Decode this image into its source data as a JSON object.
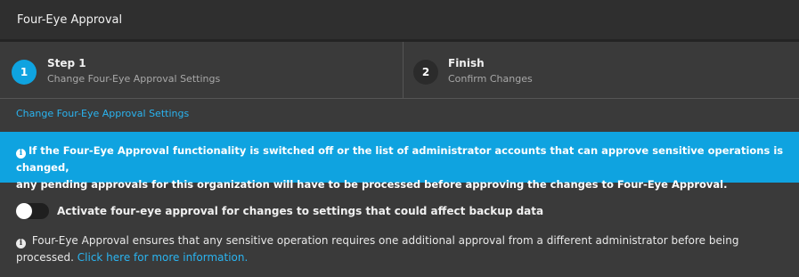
{
  "window": {
    "title": "Four-Eye Approval"
  },
  "steps": [
    {
      "number": "1",
      "title": "Step 1",
      "subtitle": "Change Four-Eye Approval Settings",
      "active": true
    },
    {
      "number": "2",
      "title": "Finish",
      "subtitle": "Confirm Changes",
      "active": false
    }
  ],
  "section": {
    "heading": "Change Four-Eye Approval Settings"
  },
  "banner": {
    "icon": "info-icon",
    "line1": "If the Four-Eye Approval functionality is switched off or the list of administrator accounts that can approve sensitive operations is changed,",
    "line2": "any pending approvals for this organization will have to be processed before approving the changes to Four-Eye Approval."
  },
  "toggle": {
    "label": "Activate four-eye approval for changes to settings that could affect backup data",
    "state": "off"
  },
  "note": {
    "icon": "info-icon",
    "text": "Four-Eye Approval ensures that any sensitive operation requires one additional approval from a different administrator before being processed.",
    "link_text": "Click here for more information."
  },
  "colors": {
    "accent": "#0fa3e0",
    "link": "#2ab4f0",
    "background": "#3a3a3a",
    "titlebar": "#2f2f2f"
  }
}
